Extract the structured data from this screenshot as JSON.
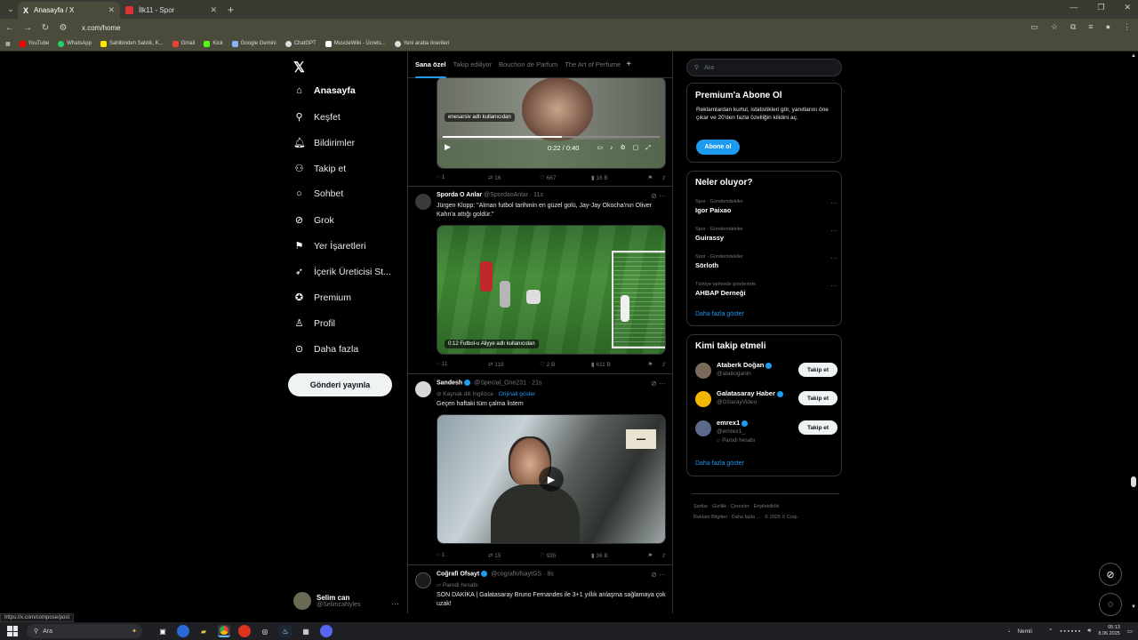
{
  "browser": {
    "tabs": [
      {
        "title": "Anasayfa / X",
        "active": true
      },
      {
        "title": "İlk11 - Spor",
        "active": false
      }
    ],
    "url": "x.com/home",
    "bookmarks": [
      "YouTube",
      "WhatsApp",
      "Sahibinden Satılık, K...",
      "Gmail",
      "Kick",
      "Google Gemini",
      "ChatGPT",
      "MuscleWiki - Ücrets...",
      "Yeni araba önerileri"
    ],
    "status_url": "https://x.com/compose/post"
  },
  "nav": {
    "items": [
      {
        "label": "Anasayfa",
        "icon": "home-icon"
      },
      {
        "label": "Keşfet",
        "icon": "search-icon"
      },
      {
        "label": "Bildirimler",
        "icon": "bell-icon"
      },
      {
        "label": "Takip et",
        "icon": "add-user-icon"
      },
      {
        "label": "Sohbet",
        "icon": "chat-icon"
      },
      {
        "label": "Grok",
        "icon": "grok-icon"
      },
      {
        "label": "Yer İşaretleri",
        "icon": "bookmark-icon"
      },
      {
        "label": "İçerik Üreticisi St...",
        "icon": "rocket-icon"
      },
      {
        "label": "Premium",
        "icon": "verified-icon"
      },
      {
        "label": "Profil",
        "icon": "person-icon"
      },
      {
        "label": "Daha fazla",
        "icon": "more-circle-icon"
      }
    ],
    "post_button": "Gönderi yayınla",
    "account": {
      "name": "Selim can",
      "handle": "@SelimcaNyles"
    }
  },
  "timeline": {
    "tabs": [
      "Sana özel",
      "Takip ediliyor",
      "Bouchon de Parfum",
      "The Art of Perfume"
    ],
    "tweet0": {
      "overlay": "enesarsiv adlı kullanıcıdan",
      "time": "0:22 / 0:40",
      "replies": "1",
      "retweets": "16",
      "likes": "667",
      "views": "16 B"
    },
    "tweet1": {
      "name": "Sporda O Anlar",
      "handle": "@SpordaoAnlar · 11s",
      "text": "Jürgen Klopp: \"Alman futbol tarihinin en güzel golü, Jay-Jay Okocha'nın Oliver Kahn'a attığı goldür.\"",
      "overlay": "0:12  Futbol-u Aliyye adlı kullanıcıdan",
      "replies": "11",
      "retweets": "119",
      "likes": "2 B",
      "views": "611 B"
    },
    "tweet2": {
      "name": "Sandesh",
      "handle": "@Special_One231 · 21s",
      "sub": "Kaynak dili İngilizce",
      "sub_link": "Orijinali göster",
      "text": "Geçen haftaki tüm çalma listem",
      "replies": "1",
      "retweets": "15",
      "likes": "935",
      "views": "36 B"
    },
    "tweet3": {
      "name": "Coğrafi Ofsayt",
      "handle": "@cografiofsaytGS · 8s",
      "sub": "Parodi hesabı",
      "text": "SON DAKİKA | Galatasaray Bruno Fernandes ile 3+1 yıllık anlaşma sağlamaya çok uzak!"
    }
  },
  "right": {
    "search_placeholder": "Ara",
    "premium": {
      "title": "Premium'a Abone Ol",
      "text": "Reklamlardan kurtul, istatistikleri gör, yanıtlarını öne çıkar ve 20'den fazla özelliğin kilidini aç.",
      "button": "Abone ol"
    },
    "trends": {
      "title": "Neler oluyor?",
      "items": [
        {
          "context": "Spor · Gündemdekiler",
          "topic": "Igor Paixao"
        },
        {
          "context": "Spor · Gündemdekiler",
          "topic": "Guirassy"
        },
        {
          "context": "Spor · Gündemdekiler",
          "topic": "Sörloth"
        },
        {
          "context": "Türkiye tarihinde gündemde",
          "topic": "AHBAP Derneği"
        }
      ],
      "show_more": "Daha fazla göster"
    },
    "who_to_follow": {
      "title": "Kimi takip etmeli",
      "items": [
        {
          "name": "Ataberk Doğan",
          "handle": "@ataboganin",
          "note": "",
          "button": "Takip et"
        },
        {
          "name": "Galatasaray Haber",
          "handle": "@GSarayVideo",
          "note": "",
          "button": "Takip et"
        },
        {
          "name": "emrex1",
          "handle": "@emrex1_",
          "note": "Parodi hesabı",
          "button": "Takip et"
        }
      ],
      "show_more": "Daha fazla göster"
    },
    "footer": [
      "Şartlar",
      "Gizlilik",
      "Çerezler",
      "Erişilebilirlik",
      "Reklam Bilgileri",
      "Daha fazla ...",
      "© 2025 X Corp."
    ]
  },
  "taskbar": {
    "search": "Ara",
    "weather": "Nemli",
    "time": "05:13",
    "date": "8.06.2025"
  }
}
